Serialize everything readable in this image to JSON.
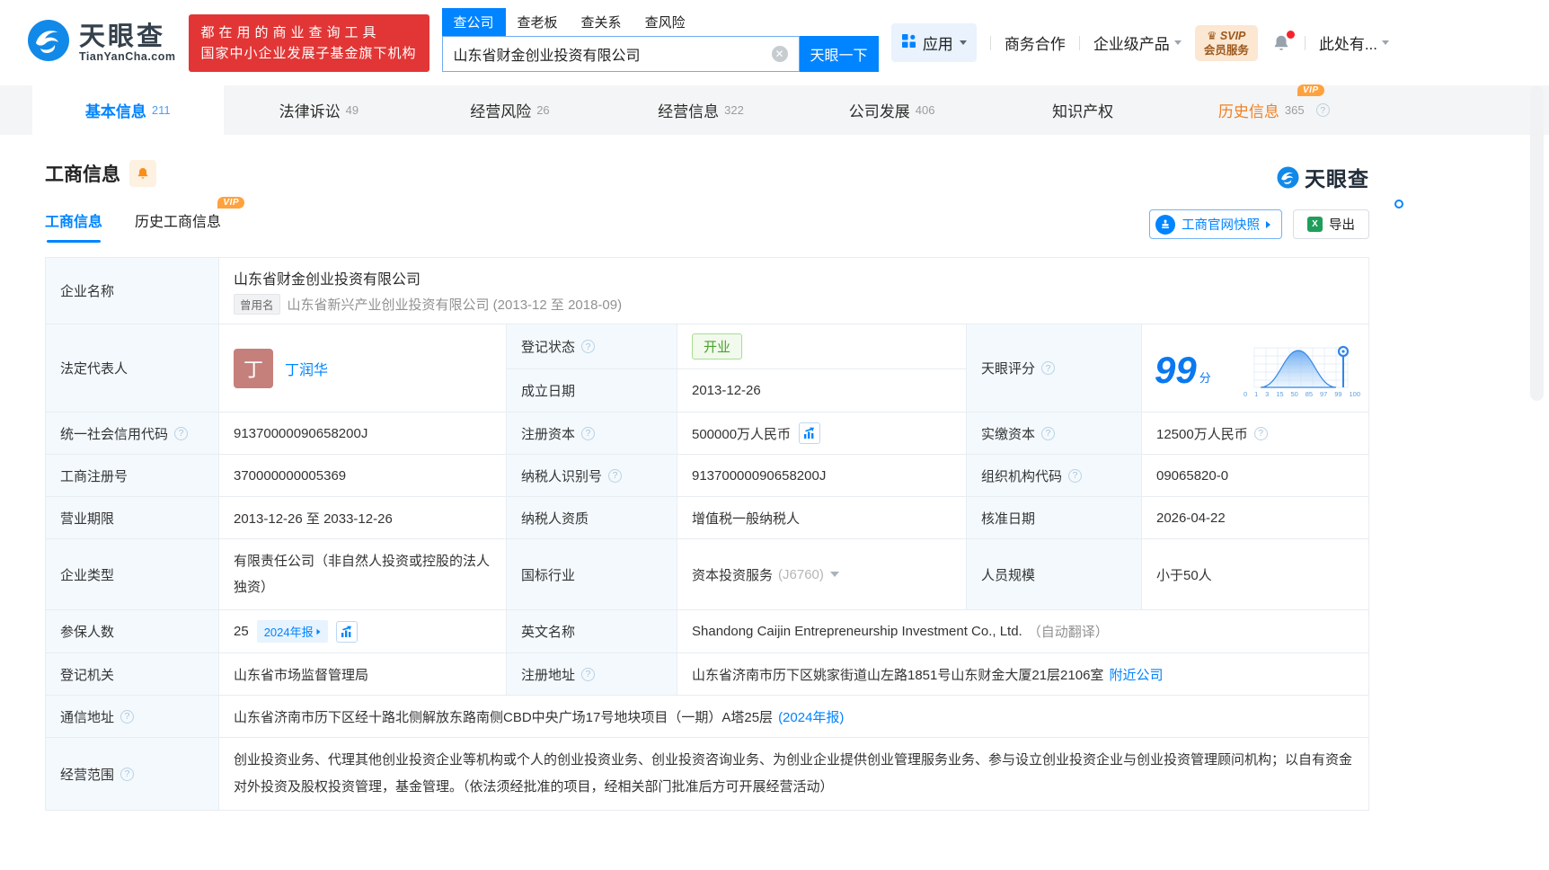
{
  "vip_badge": "VIP",
  "header": {
    "logo": {
      "title": "天眼查",
      "domain": "TianYanCha.com"
    },
    "banner": {
      "line1": "都在用的商业查询工具",
      "line2": "国家中小企业发展子基金旗下机构"
    },
    "search": {
      "tabs": [
        {
          "label": "查公司"
        },
        {
          "label": "查老板"
        },
        {
          "label": "查关系"
        },
        {
          "label": "查风险"
        }
      ],
      "value": "山东省财金创业投资有限公司",
      "button": "天眼一下"
    },
    "nav": {
      "apps": "应用",
      "coop": "商务合作",
      "enterprise": "企业级产品",
      "svip_line1": "SVIP",
      "svip_line2": "会员服务",
      "profile": "此处有..."
    }
  },
  "main_tabs": [
    {
      "label": "基本信息",
      "count": "211"
    },
    {
      "label": "法律诉讼",
      "count": "49"
    },
    {
      "label": "经营风险",
      "count": "26"
    },
    {
      "label": "经营信息",
      "count": "322"
    },
    {
      "label": "公司发展",
      "count": "406"
    },
    {
      "label": "知识产权",
      "count": ""
    },
    {
      "label": "历史信息",
      "count": "365"
    }
  ],
  "section": {
    "title": "工商信息",
    "watermark": "天眼查",
    "subtab_active": "工商信息",
    "subtab_history": "历史工商信息",
    "snapshot_button": "工商官网快照",
    "export_button": "导出"
  },
  "score": {
    "label": "天眼评分",
    "value": "99",
    "unit": "分",
    "axis": [
      "0",
      "1",
      "3",
      "15",
      "50",
      "85",
      "97",
      "99",
      "100"
    ]
  },
  "fields": {
    "name_label": "企业名称",
    "name": "山东省财金创业投资有限公司",
    "former_tag": "曾用名",
    "former_name": "山东省新兴产业创业投资有限公司 (2013-12 至 2018-09)",
    "legal_label": "法定代表人",
    "avatar": "丁",
    "legal_name": "丁润华",
    "reg_status_label": "登记状态",
    "reg_status": "开业",
    "est_label": "成立日期",
    "est_date": "2013-12-26",
    "uscc_label": "统一社会信用代码",
    "uscc": "91370000090658200J",
    "reg_capital_label": "注册资本",
    "reg_capital": "500000万人民币",
    "paid_capital_label": "实缴资本",
    "paid_capital": "12500万人民币",
    "reg_no_label": "工商注册号",
    "reg_no": "370000000005369",
    "taxpayer_id_label": "纳税人识别号",
    "taxpayer_id": "91370000090658200J",
    "org_code_label": "组织机构代码",
    "org_code": "09065820-0",
    "term_label": "营业期限",
    "term": "2013-12-26 至 2033-12-26",
    "taxpayer_quality_label": "纳税人资质",
    "taxpayer_quality": "增值税一般纳税人",
    "approval_label": "核准日期",
    "approval_date": "2026-04-22",
    "type_label": "企业类型",
    "type": "有限责任公司（非自然人投资或控股的法人独资）",
    "industry_label": "国标行业",
    "industry": "资本投资服务",
    "industry_code": "(J6760)",
    "staff_label": "人员规模",
    "staff": "小于50人",
    "insured_label": "参保人数",
    "insured": "25",
    "annual_chip": "2024年报",
    "en_name_label": "英文名称",
    "en_name": "Shandong Caijin Entrepreneurship Investment Co., Ltd.",
    "en_name_note": "（自动翻译）",
    "authority_label": "登记机关",
    "authority": "山东省市场监督管理局",
    "reg_addr_label": "注册地址",
    "reg_addr": "山东省济南市历下区姚家街道山左路1851号山东财金大厦21层2106室",
    "nearby_link": "附近公司",
    "mail_addr_label": "通信地址",
    "mail_addr": "山东省济南市历下区经十路北侧解放东路南侧CBD中央广场17号地块项目（一期）A塔25层",
    "mail_chip": "(2024年报)",
    "scope_label": "经营范围",
    "scope": "创业投资业务、代理其他创业投资企业等机构或个人的创业投资业务、创业投资咨询业务、为创业企业提供创业管理服务业务、参与设立创业投资企业与创业投资管理顾问机构；以自有资金对外投资及股权投资管理，基金管理。（依法须经批准的项目，经相关部门批准后方可开展经营活动）"
  },
  "colors": {
    "accent": "#0084ff",
    "banner_red": "#e23636",
    "vip_orange": "#ffa23e",
    "status_green": "#49a32b"
  }
}
